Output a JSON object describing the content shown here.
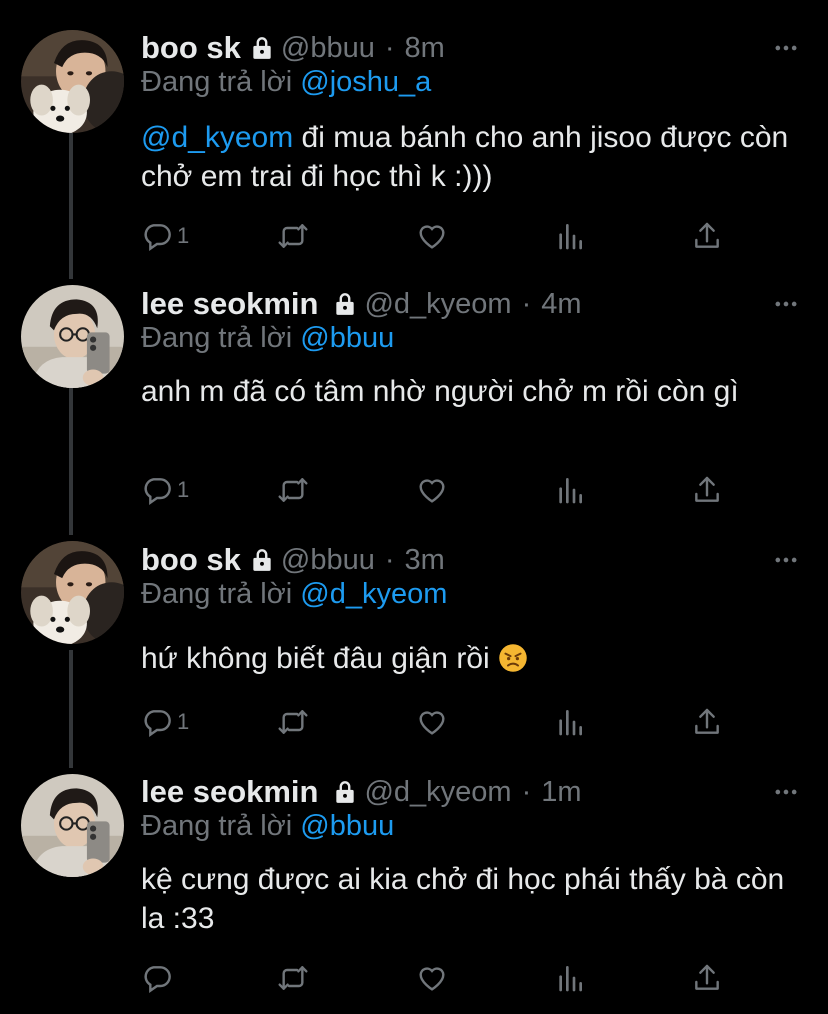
{
  "colors": {
    "background": "#000000",
    "text": "#e7e9ea",
    "muted": "#71767b",
    "accent": "#1d9bf0",
    "thread_line": "#333639"
  },
  "reply_prefix": "Đang trả lời",
  "tweets": [
    {
      "name": "boo sk",
      "handle": "@bbuu",
      "separator": "·",
      "time": "8m",
      "reply_to": "@joshu_a",
      "text_mention": "@d_kyeom",
      "text": " đi mua bánh cho anh jisoo được còn chở em trai đi học thì k :)))",
      "reply_count": "1",
      "avatar": "boy-with-dog-avatar"
    },
    {
      "name": "lee seokmin",
      "handle": "@d_kyeom",
      "separator": "·",
      "time": "4m",
      "reply_to": "@bbuu",
      "text_mention": "",
      "text": "anh m đã có tâm nhờ người chở m rồi còn gì",
      "reply_count": "1",
      "avatar": "boy-mirror-selfie-avatar"
    },
    {
      "name": "boo sk",
      "handle": "@bbuu",
      "separator": "·",
      "time": "3m",
      "reply_to": "@d_kyeom",
      "text_mention": "",
      "text": "hứ không biết đâu giận rồi ",
      "emoji": "angry-face-emoji",
      "reply_count": "1",
      "avatar": "boy-with-dog-avatar"
    },
    {
      "name": "lee seokmin",
      "handle": "@d_kyeom",
      "separator": "·",
      "time": "1m",
      "reply_to": "@bbuu",
      "text_mention": "",
      "text": "kệ cưng được ai kia chở đi học phái thấy bà còn la :33",
      "reply_count": "",
      "avatar": "boy-mirror-selfie-avatar"
    }
  ]
}
